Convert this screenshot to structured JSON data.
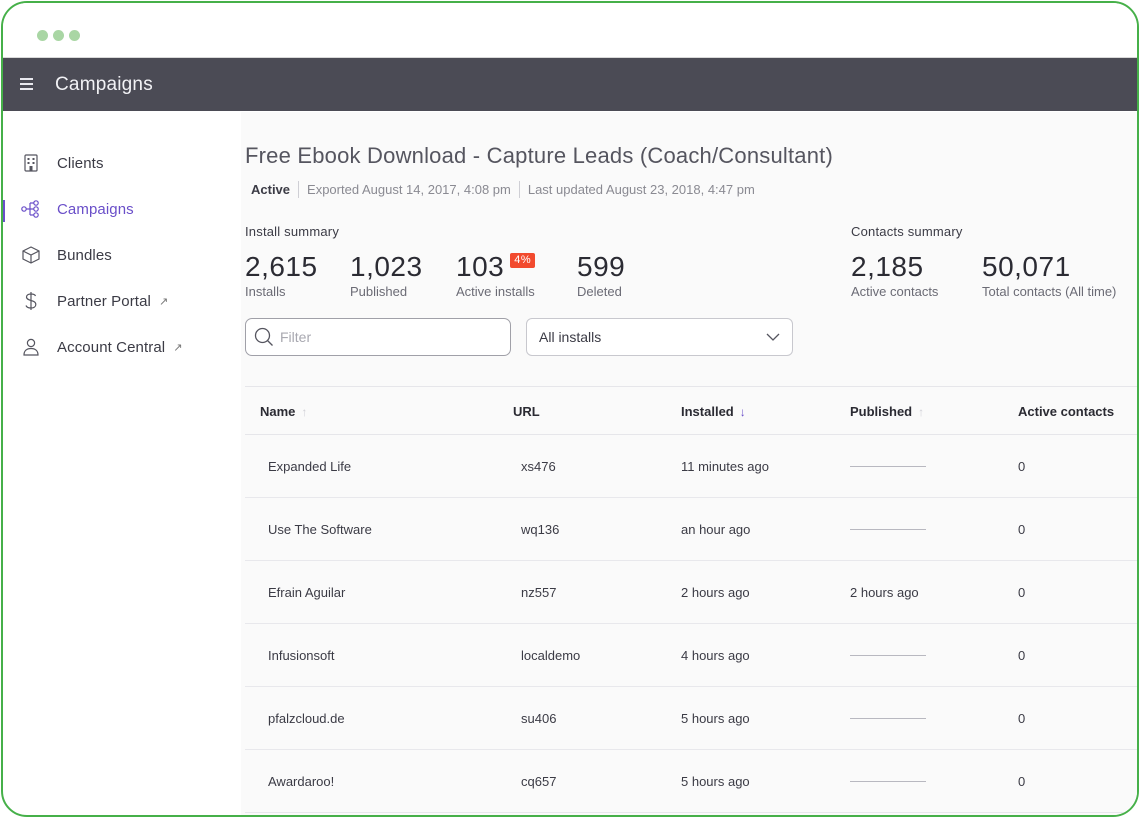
{
  "app": {
    "title": "Campaigns"
  },
  "sidebar": {
    "items": [
      {
        "label": "Clients",
        "icon": "building-icon",
        "active": false,
        "external": false
      },
      {
        "label": "Campaigns",
        "icon": "flow-icon",
        "active": true,
        "external": false
      },
      {
        "label": "Bundles",
        "icon": "box-icon",
        "active": false,
        "external": false
      },
      {
        "label": "Partner Portal",
        "icon": "dollar-icon",
        "active": false,
        "external": true
      },
      {
        "label": "Account Central",
        "icon": "user-icon",
        "active": false,
        "external": true
      }
    ],
    "external_glyph": "↗"
  },
  "campaign": {
    "title": "Free Ebook Download - Capture Leads (Coach/Consultant)",
    "status": "Active",
    "exported": "Exported August 14, 2017, 4:08 pm",
    "updated": "Last updated August 23, 2018, 4:47 pm"
  },
  "install_summary": {
    "label": "Install summary",
    "installs": {
      "value": "2,615",
      "caption": "Installs"
    },
    "published": {
      "value": "1,023",
      "caption": "Published"
    },
    "active": {
      "value": "103",
      "badge": "4%",
      "caption": "Active installs"
    },
    "deleted": {
      "value": "599",
      "caption": "Deleted"
    }
  },
  "contacts_summary": {
    "label": "Contacts summary",
    "active": {
      "value": "2,185",
      "caption": "Active contacts"
    },
    "total": {
      "value": "50,071",
      "caption": "Total contacts (All time)"
    }
  },
  "filter": {
    "placeholder": "Filter"
  },
  "installs_select": {
    "value": "All installs"
  },
  "table": {
    "columns": [
      "Name",
      "URL",
      "Installed",
      "Published",
      "Active contacts"
    ],
    "rows": [
      {
        "name": "Expanded Life",
        "url": "xs476",
        "installed": "11 minutes ago",
        "published": "",
        "active_contacts": "0"
      },
      {
        "name": "Use The Software",
        "url": "wq136",
        "installed": "an hour ago",
        "published": "",
        "active_contacts": "0"
      },
      {
        "name": "Efrain Aguilar",
        "url": "nz557",
        "installed": "2 hours ago",
        "published": "2 hours ago",
        "active_contacts": "0"
      },
      {
        "name": "Infusionsoft",
        "url": "localdemo",
        "installed": "4 hours ago",
        "published": "",
        "active_contacts": "0"
      },
      {
        "name": "pfalzcloud.de",
        "url": "su406",
        "installed": "5 hours ago",
        "published": "",
        "active_contacts": "0"
      },
      {
        "name": "Awardaroo!",
        "url": "cq657",
        "installed": "5 hours ago",
        "published": "",
        "active_contacts": "0"
      }
    ]
  },
  "colors": {
    "accent": "#6a4fc9",
    "appbar": "#4b4b55",
    "badge": "#f24a2e",
    "frame": "#46b049"
  }
}
